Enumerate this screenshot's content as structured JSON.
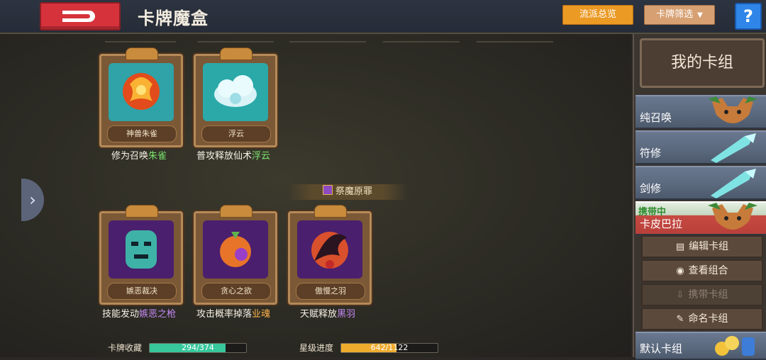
{
  "header": {
    "title": "卡牌魔盒",
    "sect_overview": "流派总览",
    "card_filter": "卡牌筛选",
    "help": "?"
  },
  "cards_top": [
    {
      "name": "神兽朱雀",
      "caption_plain": "修为召唤",
      "caption_hl": "朱雀",
      "hl_color": "green",
      "art": "phoenix"
    },
    {
      "name": "浮云",
      "caption_plain": "普攻释放仙术",
      "caption_hl": "浮云",
      "hl_color": "green",
      "art": "cloud"
    }
  ],
  "section": {
    "label": "祭魔原罪"
  },
  "cards_bottom": [
    {
      "name": "嫉恶裁决",
      "caption_plain": "技能发动",
      "caption_hl": "嫉恶之枪",
      "hl_color": "purple",
      "art": "mask"
    },
    {
      "name": "贪心之欲",
      "caption_plain": "攻击概率掉落",
      "caption_hl": "业魂",
      "hl_color": "orange",
      "art": "orb"
    },
    {
      "name": "傲慢之羽",
      "caption_plain": "天赋释放",
      "caption_hl": "黑羽",
      "hl_color": "purple",
      "art": "wing"
    }
  ],
  "progress": {
    "collection_label": "卡牌收藏",
    "collection_text": "294/374",
    "collection_value": 294,
    "collection_total": 374,
    "star_label": "星级进度",
    "star_text": "642/1122",
    "star_value": 642,
    "star_total": 1122
  },
  "right_panel": {
    "header": "我的卡组",
    "decks": [
      {
        "name": "纯召唤",
        "thumb": "beast"
      },
      {
        "name": "符修",
        "thumb": "sword"
      },
      {
        "name": "剑修",
        "thumb": "sword"
      },
      {
        "name": "卡皮巴拉",
        "thumb": "beast",
        "tag": "携带中"
      },
      {
        "name": "默认卡组",
        "thumb": "coins"
      }
    ],
    "actions": [
      {
        "label": "编辑卡组",
        "icon": "edit-icon",
        "enabled": true
      },
      {
        "label": "查看组合",
        "icon": "eye-icon",
        "enabled": true
      },
      {
        "label": "携带卡组",
        "icon": "download-icon",
        "enabled": false
      },
      {
        "label": "命名卡组",
        "icon": "pen-icon",
        "enabled": true
      }
    ]
  },
  "colors": {
    "accent_orange": "#eb9a24",
    "back_red": "#d6323b",
    "help_blue": "#2f86e8",
    "highlight_green": "#7be36d",
    "highlight_purple": "#c78af7",
    "highlight_orange": "#ffb44b"
  }
}
